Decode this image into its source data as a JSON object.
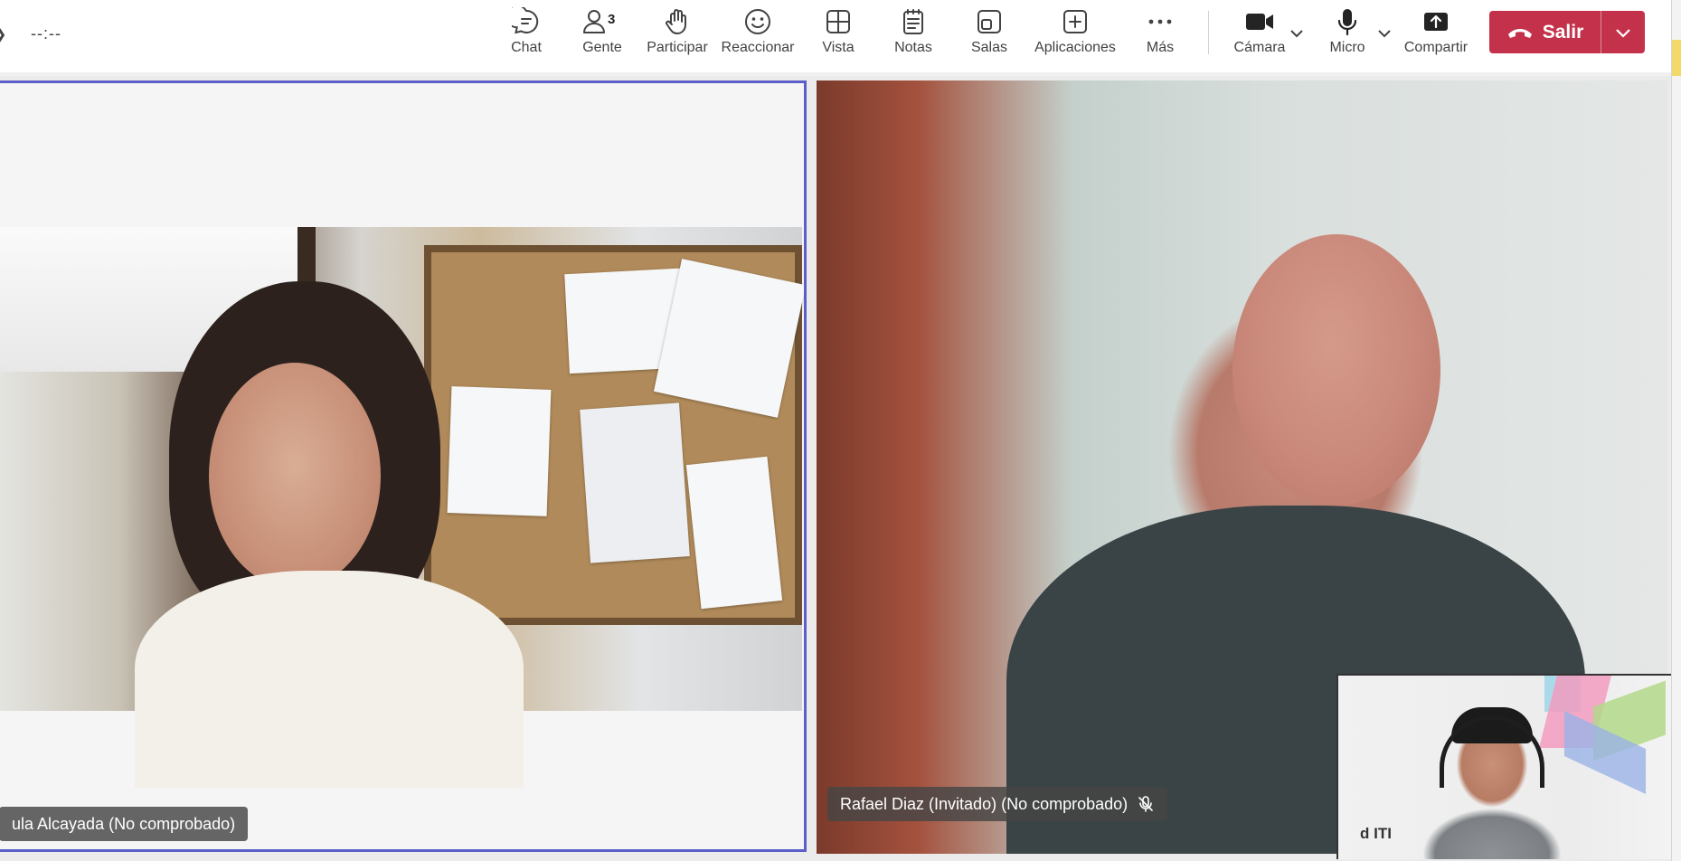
{
  "meeting": {
    "timer": "--:--"
  },
  "toolbar": {
    "items": [
      {
        "label": "Chat",
        "icon": "chat-icon"
      },
      {
        "label": "Gente",
        "icon": "people-icon",
        "badge": "3"
      },
      {
        "label": "Participar",
        "icon": "raise-hand-icon"
      },
      {
        "label": "Reaccionar",
        "icon": "smiley-icon"
      },
      {
        "label": "Vista",
        "icon": "grid-view-icon"
      },
      {
        "label": "Notas",
        "icon": "notes-icon"
      },
      {
        "label": "Salas",
        "icon": "breakout-rooms-icon"
      },
      {
        "label": "Aplicaciones",
        "icon": "add-apps-icon"
      },
      {
        "label": "Más",
        "icon": "more-icon"
      },
      {
        "label": "Cámara",
        "icon": "camera-icon"
      },
      {
        "label": "Micro",
        "icon": "microphone-icon"
      },
      {
        "label": "Compartir",
        "icon": "share-screen-icon"
      }
    ],
    "leave_label": "Salir"
  },
  "participants": {
    "left_name": "ula Alcayada (No comprobado)",
    "right_name": "Rafael Diaz (Invitado) (No comprobado)",
    "pip_logo": "ITI b"
  },
  "colors": {
    "accent": "#5b5fc7",
    "leave": "#c4314b",
    "toolbar_bg": "#ffffff"
  }
}
